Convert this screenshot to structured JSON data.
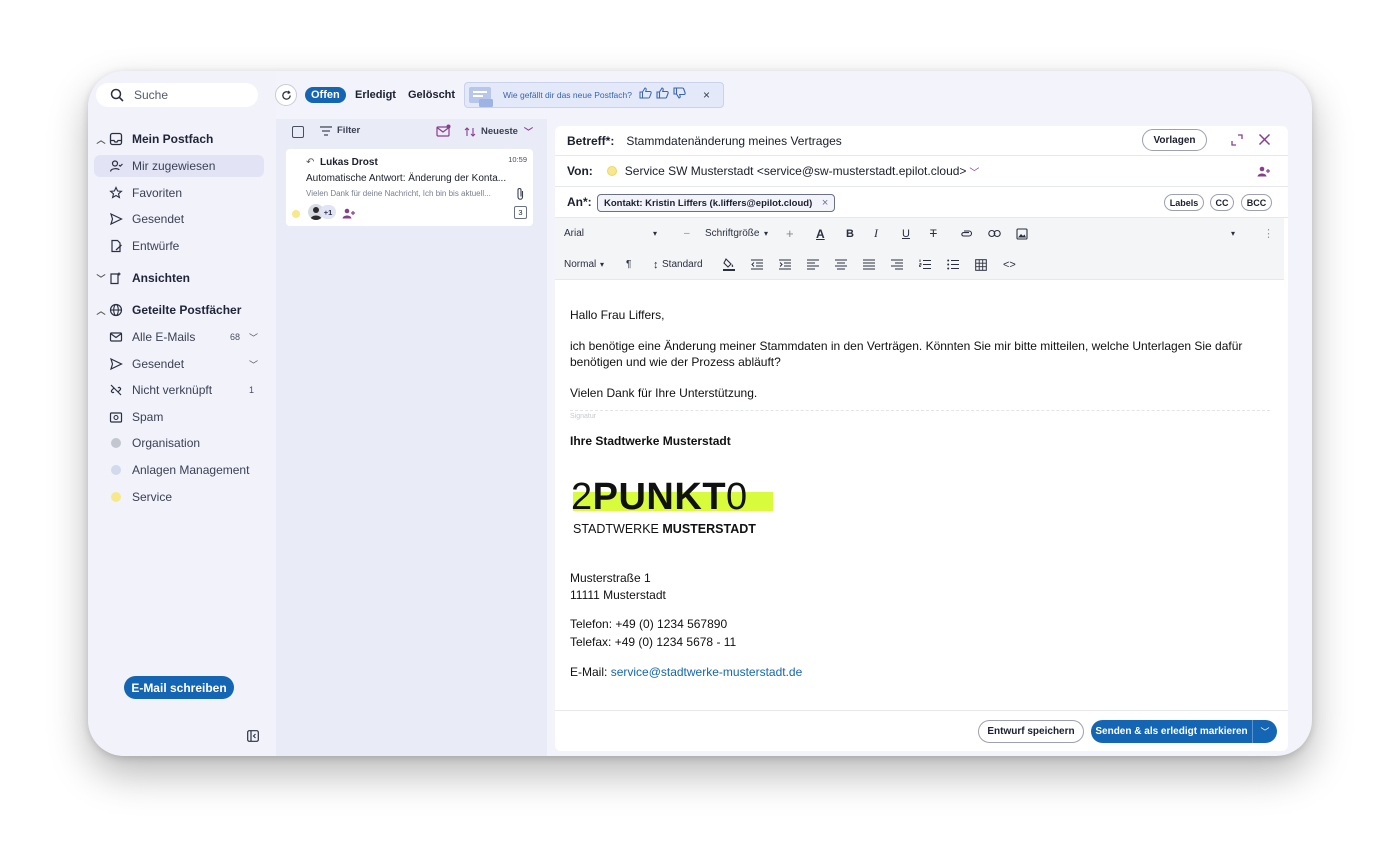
{
  "search": {
    "placeholder": "Suche"
  },
  "sidebar": {
    "sections": [
      {
        "label": "Mein Postfach"
      },
      {
        "label": "Ansichten"
      },
      {
        "label": "Geteilte Postfächer"
      }
    ],
    "items": [
      {
        "label": "Mir zugewiesen"
      },
      {
        "label": "Favoriten"
      },
      {
        "label": "Gesendet"
      },
      {
        "label": "Entwürfe"
      },
      {
        "label": "Alle E-Mails",
        "count": "68"
      },
      {
        "label": "Gesendet"
      },
      {
        "label": "Nicht verknüpft",
        "count": "1"
      },
      {
        "label": "Spam"
      },
      {
        "label": "Organisation",
        "color": "#c4c6cf"
      },
      {
        "label": "Anlagen Management",
        "color": "#d2d9ea"
      },
      {
        "label": "Service",
        "color": "#f7e98b"
      }
    ],
    "write_button": "E-Mail schreiben"
  },
  "toolbar": {
    "tabs": [
      "Offen",
      "Erledigt",
      "Gelöscht"
    ],
    "feedback_question": "Wie gefällt dir das neue Postfach?",
    "feedback_close": "×"
  },
  "list": {
    "filter_label": "Filter",
    "sort_label": "Neueste",
    "mail": {
      "sender": "Lukas Drost",
      "time": "10:59",
      "subject": "Automatische Antwort: Änderung der Konta...",
      "preview": "Vielen Dank für deine Nachricht, Ich bin bis aktuell...",
      "avatar_extra": "+1",
      "thread_count": "3"
    }
  },
  "compose": {
    "subject_label": "Betreff*:",
    "subject_value": "Stammdatenänderung meines Vertrages",
    "templates_button": "Vorlagen",
    "from_label": "Von:",
    "from_value": "Service SW Musterstadt <service@sw-musterstadt.epilot.cloud>",
    "to_label": "An*:",
    "to_chip": "Kontakt: Kristin Liffers (k.liffers@epilot.cloud)",
    "labels_button": "Labels",
    "cc_button": "CC",
    "bcc_button": "BCC",
    "font": "Arial",
    "font_size": "Schriftgröße",
    "paragraph_style": "Normal",
    "line_height": "Standard",
    "body": {
      "greeting": "Hallo Frau Liffers,",
      "paragraph1": "ich benötige eine Änderung meiner Stammdaten in den Verträgen. Könnten Sie mir bitte mitteilen, welche Unterlagen Sie dafür benötigen und wie der Prozess abläuft?",
      "thanks": "Vielen Dank für Ihre Unterstützung.",
      "signature_marker": "Signatur",
      "company": "Ihre Stadtwerke Musterstadt",
      "logo_main_light": "2",
      "logo_main_bold": "PUNKT",
      "logo_main_end": "0",
      "logo_sub_light": "STADTWERKE",
      "logo_sub_bold": "MUSTERSTADT",
      "street": "Musterstraße 1",
      "city": "11111 Musterstadt",
      "phone": "Telefon: +49 (0) 1234 567890",
      "fax": "Telefax: +49 (0) 1234 5678 - 11",
      "email_label": "E-Mail:",
      "email_value": "service@stadtwerke-musterstadt.de"
    },
    "save_draft_button": "Entwurf speichern",
    "send_button": "Senden & als erledigt markieren"
  }
}
